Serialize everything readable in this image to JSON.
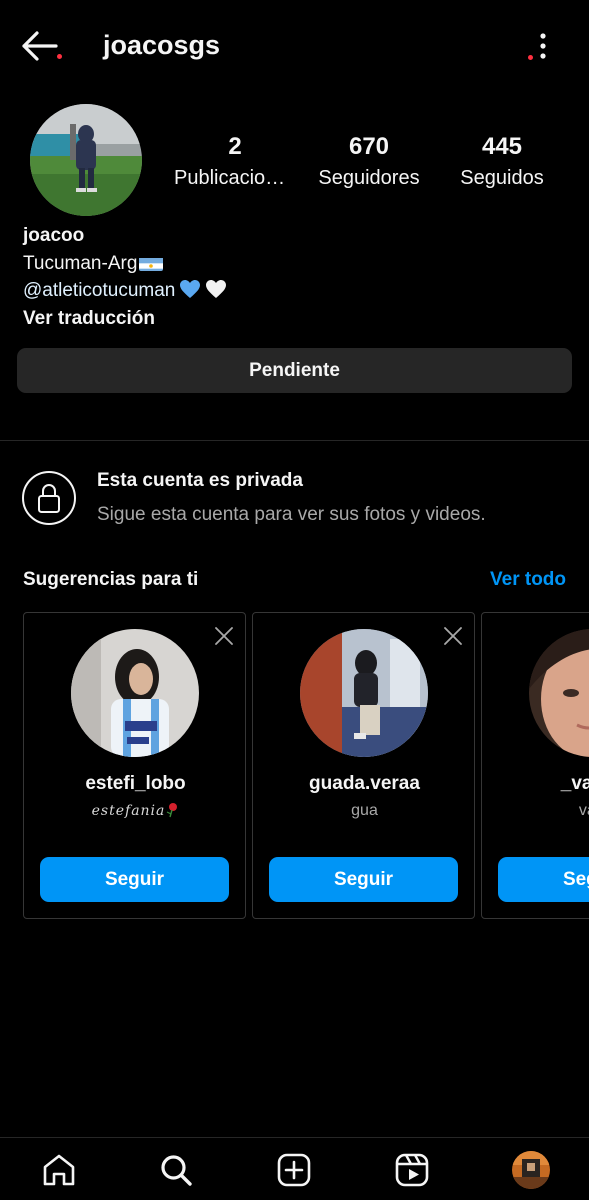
{
  "header": {
    "username": "joacosgs"
  },
  "profile": {
    "stats": {
      "posts": {
        "count": "2",
        "label": "Publicaciones"
      },
      "followers": {
        "count": "670",
        "label": "Seguidores"
      },
      "following": {
        "count": "445",
        "label": "Seguidos"
      }
    },
    "bio": {
      "name": "joacoo",
      "location": "Tucuman-Arg",
      "mention": "@atleticotucuman",
      "translate": "Ver traducción"
    },
    "pending_button": "Pendiente"
  },
  "private_notice": {
    "title": "Esta cuenta es privada",
    "subtitle": "Sigue esta cuenta para ver sus fotos y videos."
  },
  "suggestions": {
    "title": "Sugerencias para ti",
    "see_all": "Ver todo",
    "follow_label": "Seguir",
    "cards": [
      {
        "username": "estefi_lobo",
        "full_name": "estefania"
      },
      {
        "username": "guada.veraa",
        "full_name": "gua"
      },
      {
        "username": "_valent",
        "full_name": "vale"
      }
    ]
  },
  "icons": {
    "back": "arrow-left-icon",
    "more": "more-vertical-icon",
    "lock": "lock-icon",
    "close": "close-icon",
    "home": "home-icon",
    "search": "search-icon",
    "create": "plus-square-icon",
    "reels": "reels-icon",
    "profile": "profile-avatar"
  },
  "colors": {
    "background": "#000000",
    "accent": "#0095f6",
    "button_gray": "#262626",
    "secondary_text": "#a8a8a8",
    "notification_dot": "#ff3040"
  }
}
